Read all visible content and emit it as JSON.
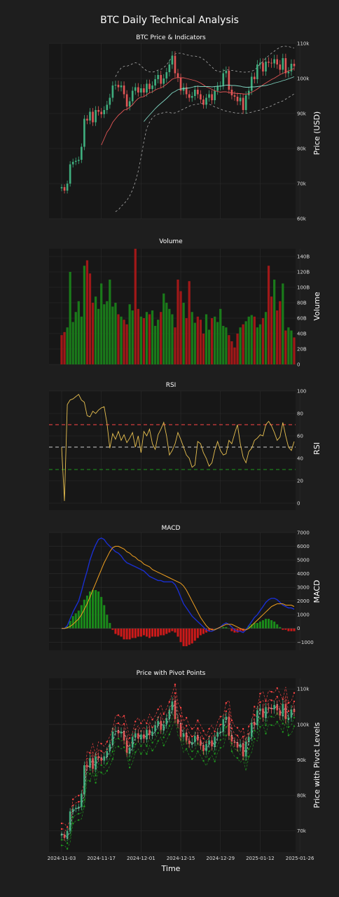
{
  "title": "BTC Daily Technical Analysis",
  "xlabel": "Time",
  "colors": {
    "background": "#1e1e1e",
    "up": "#3fae7e",
    "down": "#e05555",
    "volume_up": "#1a7a1a",
    "volume_down": "#a01818",
    "rsi_line": "#e8c050",
    "macd_line": "#1a2fd0",
    "signal_line": "#f0a020",
    "hist_pos": "#1a8a1a",
    "hist_neg": "#cc1a1a",
    "sma_fast": "#e05555",
    "sma_slow": "#7fd3c0",
    "bbands": "#aaaaaa",
    "pivot_resistance": "#ff4444",
    "pivot_support": "#1f9a1f"
  },
  "x_ticks": [
    "2024-11-03",
    "2024-11-17",
    "2024-12-01",
    "2024-12-15",
    "2024-12-29",
    "2025-01-12",
    "2025-01-26"
  ],
  "chart_data": [
    {
      "type": "candlestick",
      "title": "BTC Price & Indicators",
      "ylabel": "Price (USD)",
      "ylim": [
        60000,
        110000
      ],
      "y_ticks": [
        "60k",
        "70k",
        "80k",
        "90k",
        "100k",
        "110k"
      ],
      "x_start": "2024-11-03",
      "close": [
        69000,
        68000,
        70000,
        75500,
        76200,
        76500,
        76800,
        80500,
        88500,
        88000,
        90500,
        87500,
        91000,
        90500,
        89800,
        91000,
        92500,
        94500,
        98000,
        98200,
        97500,
        98000,
        95500,
        92000,
        93500,
        96500,
        97500,
        96000,
        97200,
        96000,
        98500,
        97000,
        98000,
        99800,
        101000,
        98500,
        100000,
        101800,
        104000,
        106500,
        101500,
        100200,
        96500,
        97500,
        95500,
        94500,
        95000,
        96800,
        95500,
        94000,
        92500,
        94500,
        95500,
        93800,
        96500,
        97800,
        98000,
        101500,
        102200,
        96800,
        95200,
        94800,
        93500,
        94500,
        91000,
        95200,
        96500,
        100500,
        99800,
        104000,
        104500,
        102000,
        104800,
        104500,
        104300,
        105500,
        104000,
        102500,
        105800,
        101500,
        102000,
        104200,
        103500
      ],
      "sma_fast": [
        null,
        null,
        null,
        null,
        null,
        null,
        null,
        null,
        null,
        null,
        null,
        null,
        null,
        null,
        81000,
        82800,
        84700,
        85800,
        87500,
        88500,
        89500,
        90200,
        91000,
        91200,
        91800,
        92500,
        93500,
        94300,
        94700,
        94800,
        95400,
        95900,
        96200,
        96700,
        97100,
        97300,
        97800,
        98400,
        99100,
        99800,
        100100,
        100300,
        100200,
        100200,
        100000,
        99800,
        99600,
        99400,
        99100,
        98700,
        98200,
        97600,
        97300,
        96900,
        96500,
        96300,
        96100,
        96200,
        96200,
        96000,
        95900,
        95800,
        95700,
        95700,
        95600,
        95500,
        95700,
        96100,
        96500,
        97000,
        97600,
        98200,
        98700,
        99200,
        99700,
        100100,
        100600,
        101100,
        101500,
        101800,
        102200,
        102500,
        102900
      ],
      "sma_slow": [
        null,
        null,
        null,
        null,
        null,
        null,
        null,
        null,
        null,
        null,
        null,
        null,
        null,
        null,
        null,
        null,
        null,
        null,
        null,
        null,
        null,
        null,
        null,
        null,
        null,
        null,
        null,
        null,
        null,
        87700,
        88700,
        89600,
        90500,
        91400,
        92200,
        92900,
        93600,
        94300,
        95100,
        95900,
        96300,
        96800,
        97000,
        97100,
        97200,
        97300,
        97500,
        97700,
        97800,
        97700,
        97700,
        97700,
        97700,
        97600,
        97700,
        97800,
        97800,
        97900,
        98100,
        98100,
        98000,
        98000,
        97900,
        97800,
        97600,
        97500,
        97500,
        97600,
        97600,
        97700,
        97800,
        97900,
        98000,
        98200,
        98400,
        98700,
        98900,
        99100,
        99400,
        99600,
        99900,
        100200,
        100500
      ],
      "bb_upper": [
        null,
        null,
        null,
        null,
        null,
        null,
        null,
        null,
        null,
        null,
        null,
        null,
        null,
        null,
        null,
        null,
        null,
        null,
        null,
        100500,
        102000,
        103000,
        103500,
        103500,
        103800,
        104200,
        104500,
        104300,
        103600,
        102800,
        102200,
        101900,
        101800,
        102000,
        102400,
        102600,
        103100,
        103900,
        105000,
        106500,
        107000,
        107200,
        107200,
        107000,
        106800,
        106600,
        106400,
        106400,
        106200,
        106000,
        105500,
        104900,
        104000,
        103300,
        102400,
        102100,
        101900,
        102200,
        102500,
        102400,
        102300,
        102200,
        102000,
        101900,
        101800,
        101800,
        101900,
        102100,
        102400,
        103200,
        104100,
        104900,
        105800,
        106500,
        107200,
        107800,
        108400,
        108900,
        109200,
        109200,
        109100,
        108900,
        108700
      ],
      "bb_lower": [
        null,
        null,
        null,
        null,
        null,
        null,
        null,
        null,
        null,
        null,
        null,
        null,
        null,
        null,
        null,
        null,
        null,
        null,
        null,
        62000,
        62500,
        63500,
        64300,
        65200,
        66500,
        68200,
        70500,
        73500,
        77500,
        82000,
        85800,
        87500,
        88800,
        89500,
        89800,
        90000,
        90300,
        90400,
        90300,
        90100,
        90200,
        90500,
        90900,
        91300,
        91700,
        92100,
        92400,
        92600,
        92700,
        92800,
        92900,
        93000,
        92700,
        92300,
        91900,
        91600,
        91300,
        90900,
        90700,
        90500,
        90400,
        90200,
        90100,
        90100,
        90000,
        90100,
        90200,
        90400,
        90600,
        90800,
        91000,
        91300,
        91600,
        91900,
        92200,
        92600,
        93000,
        93300,
        93600,
        94100,
        94600,
        95100,
        95600
      ]
    },
    {
      "type": "bar",
      "title": "Volume",
      "ylabel": "Volume",
      "ylim": [
        0,
        150
      ],
      "unit": "B",
      "y_ticks": [
        "0",
        "20B",
        "40B",
        "60B",
        "80B",
        "100B",
        "120B",
        "140B"
      ],
      "values": [
        38,
        42,
        48,
        120,
        55,
        68,
        82,
        62,
        128,
        135,
        118,
        80,
        88,
        72,
        105,
        78,
        82,
        110,
        75,
        80,
        65,
        62,
        58,
        52,
        78,
        70,
        150,
        72,
        62,
        60,
        68,
        65,
        70,
        50,
        58,
        68,
        92,
        80,
        72,
        65,
        48,
        110,
        95,
        80,
        60,
        108,
        68,
        54,
        62,
        58,
        40,
        65,
        45,
        60,
        62,
        55,
        72,
        50,
        48,
        38,
        30,
        22,
        40,
        48,
        52,
        56,
        62,
        64,
        62,
        48,
        52,
        60,
        68,
        128,
        88,
        110,
        70,
        82,
        105,
        44,
        48,
        44,
        35
      ],
      "up": [
        false,
        false,
        true,
        true,
        true,
        true,
        true,
        true,
        true,
        false,
        false,
        false,
        true,
        true,
        true,
        true,
        true,
        true,
        true,
        true,
        false,
        true,
        false,
        false,
        true,
        true,
        false,
        false,
        true,
        false,
        true,
        false,
        true,
        true,
        true,
        false,
        true,
        true,
        true,
        true,
        false,
        false,
        false,
        true,
        false,
        false,
        true,
        true,
        false,
        false,
        false,
        true,
        true,
        false,
        true,
        true,
        true,
        true,
        true,
        false,
        false,
        false,
        false,
        true,
        false,
        true,
        true,
        true,
        false,
        true,
        true,
        false,
        true,
        false,
        false,
        true,
        false,
        false,
        true,
        false,
        true,
        true,
        false
      ]
    },
    {
      "type": "line",
      "title": "RSI",
      "ylabel": "RSI",
      "ylim": [
        0,
        100
      ],
      "y_ticks": [
        "0",
        "20",
        "40",
        "60",
        "80",
        "100"
      ],
      "levels": [
        70,
        50,
        30
      ],
      "values": [
        50,
        2,
        88,
        92,
        93,
        95,
        97,
        92,
        90,
        78,
        77,
        82,
        80,
        83,
        85,
        86,
        71,
        49,
        62,
        57,
        64,
        56,
        61,
        54,
        58,
        63,
        50,
        60,
        45,
        64,
        60,
        66,
        53,
        48,
        61,
        66,
        72,
        60,
        43,
        47,
        53,
        63,
        57,
        50,
        43,
        40,
        32,
        34,
        55,
        53,
        45,
        40,
        33,
        36,
        47,
        55,
        47,
        43,
        44,
        56,
        53,
        62,
        70,
        53,
        41,
        36,
        46,
        49,
        56,
        58,
        61,
        60,
        70,
        73,
        69,
        63,
        56,
        59,
        72,
        60,
        50,
        47,
        55
      ]
    },
    {
      "type": "line",
      "title": "MACD",
      "ylabel": "MACD",
      "ylim": [
        -1600,
        7000
      ],
      "y_ticks": [
        "−1000",
        "0",
        "1000",
        "2000",
        "3000",
        "4000",
        "5000",
        "6000",
        "7000"
      ],
      "macd": [
        0,
        0,
        200,
        700,
        1200,
        1600,
        2000,
        2700,
        3500,
        4200,
        5000,
        5600,
        6100,
        6500,
        6600,
        6500,
        6200,
        6000,
        5800,
        5600,
        5500,
        5300,
        5000,
        4800,
        4700,
        4600,
        4500,
        4400,
        4300,
        4200,
        4000,
        3800,
        3700,
        3600,
        3500,
        3500,
        3400,
        3400,
        3400,
        3400,
        3200,
        2800,
        2300,
        1800,
        1500,
        1200,
        900,
        700,
        500,
        300,
        100,
        -100,
        -200,
        -200,
        -100,
        0,
        100,
        300,
        400,
        300,
        100,
        -100,
        -200,
        -200,
        -300,
        -100,
        200,
        500,
        800,
        1000,
        1300,
        1600,
        1900,
        2100,
        2200,
        2200,
        2100,
        1900,
        1700,
        1600,
        1500,
        1500,
        1400
      ],
      "signal": [
        0,
        0,
        50,
        150,
        300,
        500,
        700,
        1000,
        1400,
        1800,
        2300,
        2800,
        3300,
        3800,
        4300,
        4800,
        5200,
        5600,
        5900,
        6000,
        6000,
        5900,
        5800,
        5600,
        5500,
        5300,
        5200,
        5000,
        4900,
        4700,
        4600,
        4500,
        4300,
        4200,
        4100,
        4000,
        3900,
        3800,
        3700,
        3600,
        3500,
        3400,
        3300,
        3100,
        2800,
        2400,
        2000,
        1600,
        1200,
        800,
        500,
        200,
        0,
        -100,
        -100,
        0,
        100,
        200,
        300,
        300,
        300,
        200,
        100,
        0,
        -100,
        -100,
        0,
        200,
        400,
        600,
        800,
        1000,
        1200,
        1400,
        1600,
        1700,
        1800,
        1800,
        1800,
        1700,
        1700,
        1700,
        1600
      ]
    },
    {
      "type": "candlestick",
      "title": "Price with Pivot Points",
      "ylabel": "Price with Pivot Levels",
      "ylim": [
        64000,
        113000
      ],
      "y_ticks": [
        "70k",
        "80k",
        "90k",
        "100k",
        "110k"
      ]
    }
  ]
}
